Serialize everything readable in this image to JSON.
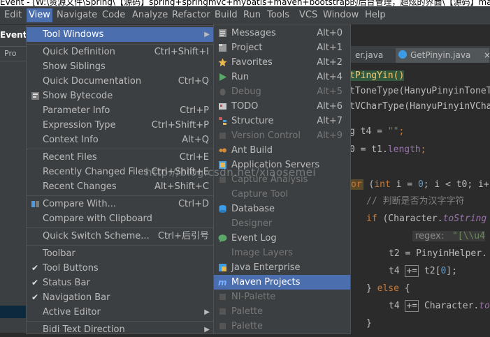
{
  "title_bar": {
    "text": "Event - [W:\\资源文件\\Spring\\【源码】spring+springmvc+mybatis+maven+bootstrap的后台管理，超炫的界面\\【源码】maven"
  },
  "menubar": {
    "items": [
      "Edit",
      "View",
      "Navigate",
      "Code",
      "Analyze",
      "Refactor",
      "Build",
      "Run",
      "Tools",
      "VCS",
      "Window",
      "Help"
    ]
  },
  "left_panel": {
    "event_label": "Event",
    "project_tab": "Pro"
  },
  "editor": {
    "tabs": [
      {
        "label": "er.java"
      },
      {
        "label": "GetPinyin.java",
        "close": "×"
      }
    ],
    "lines": {
      "l1": "tPingYin()",
      "l2": "tToneType(HanyuPinyinToneT",
      "l3": "tVCharType(HanyuPinyinVCha",
      "l4a": "g t4 = ",
      "l4b": "\"\"",
      "l4c": ";",
      "l5a": "0 = t1.",
      "l5b": "length",
      "l5c": ";",
      "l6a": "or",
      "l6b": " (",
      "l6c": "int",
      "l6d": " i = ",
      "l6e": "0",
      "l6f": "; i < t0; i+",
      "l7": "// 判断是否为汉字字符",
      "l8a": "if",
      "l8b": " (Character.",
      "l8c": "toString",
      "l9a": "regex:",
      "l9b": " \"[\\\\u4",
      "l10": "t2 = PinyinHelper.",
      "l11a": "t4 ",
      "l11b": "+=",
      "l11c": " t2[",
      "l11d": "0",
      "l11e": "];",
      "l12a": "} ",
      "l12b": "else",
      "l12c": " {",
      "l13a": "t4 ",
      "l13b": "+=",
      "l13c": " Character.",
      "l13d": "to",
      "l14": "}"
    }
  },
  "view_menu": {
    "items": [
      {
        "label": "Tool Windows",
        "shortcut": ""
      },
      {
        "label": "Quick Definition",
        "shortcut": "Ctrl+Shift+I"
      },
      {
        "label": "Show Siblings",
        "shortcut": ""
      },
      {
        "label": "Quick Documentation",
        "shortcut": "Ctrl+Q"
      },
      {
        "label": "Show Bytecode",
        "shortcut": ""
      },
      {
        "label": "Parameter Info",
        "shortcut": "Ctrl+P"
      },
      {
        "label": "Expression Type",
        "shortcut": "Ctrl+Shift+P"
      },
      {
        "label": "Context Info",
        "shortcut": "Alt+Q"
      },
      {
        "label": "Recent Files",
        "shortcut": "Ctrl+E"
      },
      {
        "label": "Recently Changed Files",
        "shortcut": "Ctrl+Shift+E"
      },
      {
        "label": "Recent Changes",
        "shortcut": "Alt+Shift+C"
      },
      {
        "label": "Compare With...",
        "shortcut": "Ctrl+D"
      },
      {
        "label": "Compare with Clipboard",
        "shortcut": ""
      },
      {
        "label": "Quick Switch Scheme...",
        "shortcut": "Ctrl+后引号"
      },
      {
        "label": "Toolbar",
        "shortcut": ""
      },
      {
        "label": "Tool Buttons",
        "shortcut": ""
      },
      {
        "label": "Status Bar",
        "shortcut": ""
      },
      {
        "label": "Navigation Bar",
        "shortcut": ""
      },
      {
        "label": "Active Editor",
        "shortcut": ""
      },
      {
        "label": "Bidi Text Direction",
        "shortcut": ""
      }
    ]
  },
  "tool_windows_menu": {
    "items": [
      {
        "label": "Messages",
        "shortcut": "Alt+0"
      },
      {
        "label": "Project",
        "shortcut": "Alt+1"
      },
      {
        "label": "Favorites",
        "shortcut": "Alt+2"
      },
      {
        "label": "Run",
        "shortcut": "Alt+4"
      },
      {
        "label": "Debug",
        "shortcut": "Alt+5"
      },
      {
        "label": "TODO",
        "shortcut": "Alt+6"
      },
      {
        "label": "Structure",
        "shortcut": "Alt+7"
      },
      {
        "label": "Version Control",
        "shortcut": "Alt+9"
      },
      {
        "label": "Ant Build",
        "shortcut": ""
      },
      {
        "label": "Application Servers",
        "shortcut": ""
      },
      {
        "label": "Capture Analysis",
        "shortcut": ""
      },
      {
        "label": "Capture Tool",
        "shortcut": ""
      },
      {
        "label": "Database",
        "shortcut": ""
      },
      {
        "label": "Designer",
        "shortcut": ""
      },
      {
        "label": "Event Log",
        "shortcut": ""
      },
      {
        "label": "Image Layers",
        "shortcut": ""
      },
      {
        "label": "Java Enterprise",
        "shortcut": ""
      },
      {
        "label": "Maven Projects",
        "shortcut": ""
      },
      {
        "label": "NI-Palette",
        "shortcut": ""
      },
      {
        "label": "Palette",
        "shortcut": ""
      },
      {
        "label": "Palette",
        "shortcut": ""
      }
    ]
  },
  "watermark": {
    "text": "http://blog.csdn.net/xiaosemei"
  },
  "colors": {
    "accent": "#4b6eaf",
    "menu_bg": "#3c3f41",
    "editor_bg": "#2b2b2b"
  }
}
